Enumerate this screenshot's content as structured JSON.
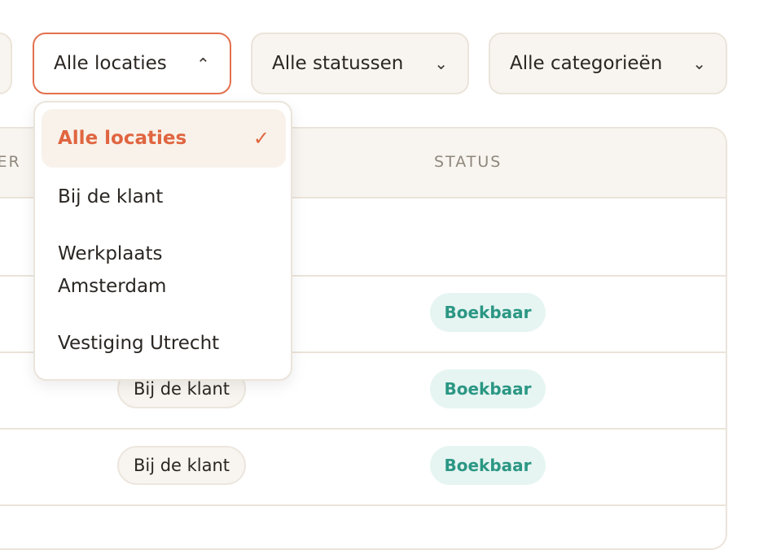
{
  "filters": {
    "location": {
      "label": "Alle locaties",
      "open": true
    },
    "status": {
      "label": "Alle statussen"
    },
    "category": {
      "label": "Alle categorieën"
    }
  },
  "dropdown": {
    "options": [
      {
        "label": "Alle locaties",
        "selected": true
      },
      {
        "label": "Bij de klant"
      },
      {
        "label": "Werkplaats Amsterdam"
      },
      {
        "label": "Vestiging Utrecht"
      }
    ]
  },
  "table": {
    "headers": {
      "left_partial": "KER",
      "status": "STATUS"
    },
    "rows": [
      {
        "location": "",
        "status": ""
      },
      {
        "location": "",
        "status": "Boekbaar"
      },
      {
        "location": "Bij de klant",
        "status": "Boekbaar"
      },
      {
        "location": "Bij de klant",
        "status": "Boekbaar"
      }
    ]
  },
  "colors": {
    "accent": "#e3704d",
    "status_ok_bg": "#e6f5f2",
    "status_ok_text": "#2b9784",
    "surface": "#f8f5f0",
    "border": "#ebe4da"
  },
  "icons": {
    "open": "chevron-up-icon",
    "closed": "chevron-down-icon",
    "check": "check-icon"
  }
}
